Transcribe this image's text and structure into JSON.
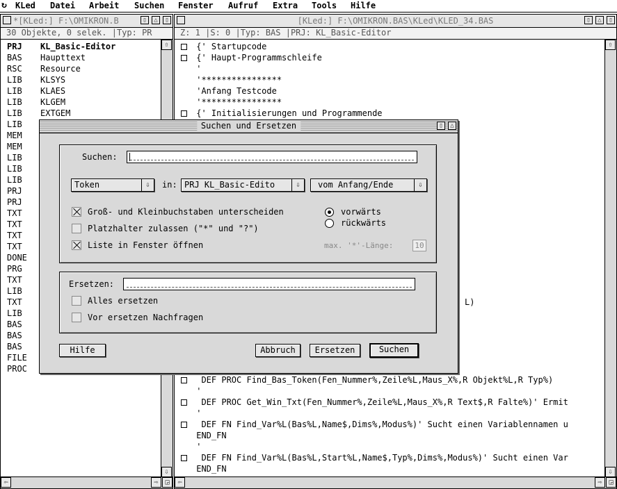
{
  "menubar": {
    "app": "KLed",
    "items": [
      "Datei",
      "Arbeit",
      "Suchen",
      "Fenster",
      "Aufruf",
      "Extra",
      "Tools",
      "Hilfe"
    ]
  },
  "left_window": {
    "title": "*[KLed:] F:\\OMIKRON.B",
    "info": "30 Objekte, 0 selek. |Typ: PR",
    "rows": [
      {
        "type": "PRJ",
        "name": "KL_Basic-Editor"
      },
      {
        "type": "BAS",
        "name": "Haupttext"
      },
      {
        "type": "RSC",
        "name": "Resource"
      },
      {
        "type": "LIB",
        "name": "KLSYS"
      },
      {
        "type": "LIB",
        "name": "KLAES"
      },
      {
        "type": "LIB",
        "name": "KLGEM"
      },
      {
        "type": "LIB",
        "name": "EXTGEM"
      },
      {
        "type": "LIB",
        "name": ""
      },
      {
        "type": "MEM",
        "name": ""
      },
      {
        "type": "MEM",
        "name": ""
      },
      {
        "type": "LIB",
        "name": ""
      },
      {
        "type": "LIB",
        "name": ""
      },
      {
        "type": "LIB",
        "name": ""
      },
      {
        "type": "PRJ",
        "name": ""
      },
      {
        "type": "PRJ",
        "name": ""
      },
      {
        "type": "TXT",
        "name": ""
      },
      {
        "type": "TXT",
        "name": ""
      },
      {
        "type": "TXT",
        "name": ""
      },
      {
        "type": "TXT",
        "name": ""
      },
      {
        "type": "DONE",
        "name": ""
      },
      {
        "type": "PRG",
        "name": ""
      },
      {
        "type": "TXT",
        "name": ""
      },
      {
        "type": "LIB",
        "name": ""
      },
      {
        "type": "TXT",
        "name": ""
      },
      {
        "type": "LIB",
        "name": ""
      },
      {
        "type": "BAS",
        "name": ""
      },
      {
        "type": "BAS",
        "name": ""
      },
      {
        "type": "BAS",
        "name": ""
      },
      {
        "type": "FILE",
        "name": ""
      },
      {
        "type": "PROC",
        "name": ""
      }
    ]
  },
  "right_window": {
    "title": "[KLed:] F:\\OMIKRON.BAS\\KLed\\KLED_34.BAS",
    "info": "Z:    1 |S:  0 |Typ: BAS |PRJ: KL_Basic-Editor",
    "top_lines": [
      {
        "box": true,
        "text": " {' Startupcode"
      },
      {
        "box": true,
        "text": " {' Haupt-Programmschleife"
      },
      {
        "box": false,
        "text": " '"
      },
      {
        "box": false,
        "text": " '****************"
      },
      {
        "box": false,
        "text": " 'Anfang Testcode"
      },
      {
        "box": false,
        "text": " '****************"
      },
      {
        "box": true,
        "text": " {' Initialisierungen und Programmende"
      }
    ],
    "partial_line": "L)",
    "bottom_lines": [
      {
        "box": true,
        "text": "  DEF PROC Find_Bas_Token(Fen_Nummer%,Zeile%L,Maus_X%,R Objekt%L,R Typ%)"
      },
      {
        "box": false,
        "text": " '"
      },
      {
        "box": true,
        "text": "  DEF PROC Get_Win_Txt(Fen_Nummer%,Zeile%L,Maus_X%,R Text$,R Falte%)' Ermit"
      },
      {
        "box": false,
        "text": " '"
      },
      {
        "box": true,
        "text": "  DEF FN Find_Var%L(Bas%L,Name$,Dims%,Modus%)' Sucht einen Variablennamen u"
      },
      {
        "box": false,
        "text": " END_FN"
      },
      {
        "box": false,
        "text": " '"
      },
      {
        "box": true,
        "text": "  DEF FN Find_Var%L(Bas%L,Start%L,Name$,Typ%,Dims%,Modus%)' Sucht einen Var"
      },
      {
        "box": false,
        "text": " END_FN"
      }
    ]
  },
  "dialog": {
    "title": "Suchen und Ersetzen",
    "search_label": "Suchen:",
    "search_value": "",
    "token_popup": "Token",
    "in_label": "in:",
    "scope_popup": "PRJ KL_Basic-Edito",
    "origin_popup": "vom Anfang/Ende",
    "opt_case": {
      "label": "Groß- und Kleinbuchstaben unterscheiden",
      "checked": true
    },
    "opt_wildcard": {
      "label": "Platzhalter zulassen (\"*\" und \"?\")",
      "checked": false
    },
    "opt_list": {
      "label": "Liste in Fenster öffnen",
      "checked": true
    },
    "dir_forward": {
      "label": "vorwärts",
      "selected": true
    },
    "dir_backward": {
      "label": "rückwärts",
      "selected": false
    },
    "max_len_label": "max. '*'-Länge:",
    "max_len_value": "10",
    "replace_label": "Ersetzen:",
    "replace_value": "",
    "opt_replace_all": {
      "label": "Alles ersetzen",
      "checked": false
    },
    "opt_confirm": {
      "label": "Vor ersetzen Nachfragen",
      "checked": false
    },
    "btn_help": "Hilfe",
    "btn_cancel": "Abbruch",
    "btn_replace": "Ersetzen",
    "btn_search": "Suchen"
  }
}
